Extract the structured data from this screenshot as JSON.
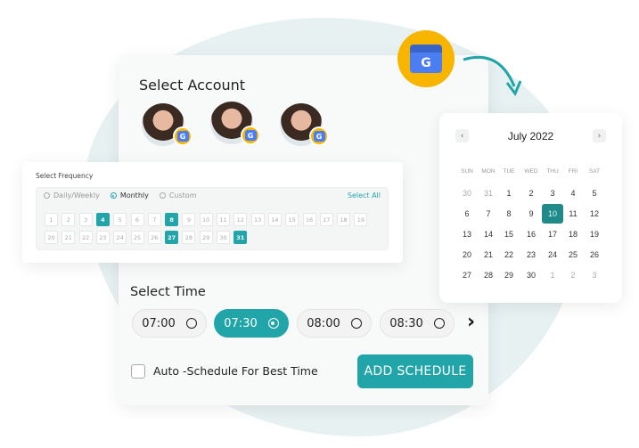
{
  "colors": {
    "accent": "#21a5a9",
    "calendar_selected": "#208a8a",
    "badge": "#f7b500"
  },
  "account": {
    "title": "Select Account",
    "avatars": [
      {
        "badge": "G"
      },
      {
        "badge": "G"
      },
      {
        "badge": "G"
      }
    ]
  },
  "logo": {
    "letter": "G",
    "icon": "google-my-business-icon"
  },
  "frequency": {
    "title": "Select Frequency",
    "options": [
      {
        "label": "Daily/Weekly",
        "selected": false
      },
      {
        "label": "Monthly",
        "selected": true
      },
      {
        "label": "Custom",
        "selected": false
      }
    ],
    "select_all": "Select All",
    "days": [
      "1",
      "2",
      "3",
      "4",
      "5",
      "6",
      "7",
      "8",
      "9",
      "10",
      "11",
      "12",
      "13",
      "14",
      "15",
      "16",
      "17",
      "18",
      "19",
      "20",
      "21",
      "22",
      "23",
      "24",
      "25",
      "26",
      "27",
      "28",
      "29",
      "30",
      "31"
    ],
    "selected_days": [
      "4",
      "8",
      "27",
      "31"
    ]
  },
  "calendar": {
    "title": "July 2022",
    "prev": "‹",
    "next": "›",
    "weekdays": [
      "SUN",
      "MON",
      "TUE",
      "WED",
      "THU",
      "FRI",
      "SAT"
    ],
    "weeks": [
      [
        "30",
        "31",
        "1",
        "2",
        "3",
        "4",
        "5"
      ],
      [
        "6",
        "7",
        "8",
        "9",
        "10",
        "11",
        "12"
      ],
      [
        "13",
        "14",
        "15",
        "16",
        "17",
        "18",
        "19"
      ],
      [
        "20",
        "21",
        "22",
        "23",
        "24",
        "25",
        "26"
      ],
      [
        "27",
        "28",
        "29",
        "30",
        "1",
        "2",
        "3"
      ]
    ],
    "muted": [
      [
        0,
        0
      ],
      [
        0,
        1
      ],
      [
        4,
        4
      ],
      [
        4,
        5
      ],
      [
        4,
        6
      ]
    ],
    "selected": "10"
  },
  "time": {
    "title": "Select Time",
    "slots": [
      {
        "label": "07:00",
        "selected": false
      },
      {
        "label": "07:30",
        "selected": true
      },
      {
        "label": "08:00",
        "selected": false
      },
      {
        "label": "08:30",
        "selected": false
      }
    ],
    "next": "›"
  },
  "auto_schedule": {
    "label": "Auto -Schedule For Best Time",
    "checked": false
  },
  "add_schedule": "ADD SCHEDULE"
}
